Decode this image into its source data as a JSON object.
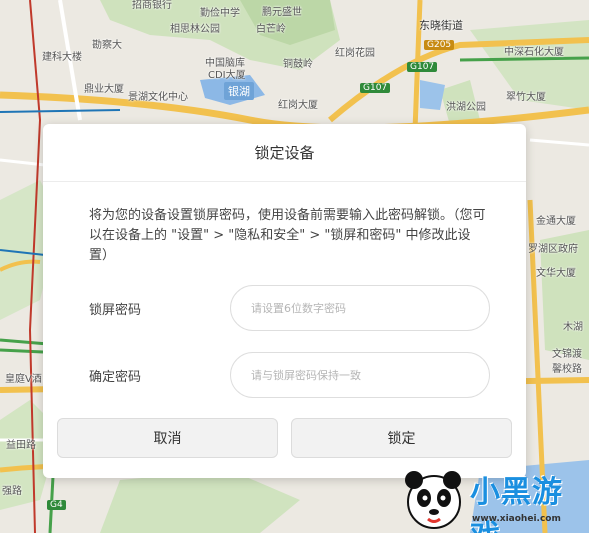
{
  "dialog": {
    "title": "锁定设备",
    "description": "将为您的设备设置锁屏密码，使用设备前需要输入此密码解锁。（您可以在设备上的 \"设置\" > \"隐私和安全\" > \"锁屏和密码\" 中修改此设置）",
    "fields": [
      {
        "label": "锁屏密码",
        "value": "",
        "placeholder": "请设置6位数字密码"
      },
      {
        "label": "确定密码",
        "value": "",
        "placeholder": "请与锁屏密码保持一致"
      }
    ],
    "cancel_label": "取消",
    "confirm_label": "锁定"
  },
  "map": {
    "labels": [
      "招商银行",
      "勤俭中学",
      "鹏元盛世",
      "相思林公园",
      "白芒岭",
      "东晓街道",
      "建科大楼",
      "勘察大",
      "中国脑库",
      "CDI大厦",
      "铜鼓岭",
      "红岗花园",
      "中深石化大厦",
      "鼎业大厦",
      "景湖文化中心",
      "银湖",
      "红岗大厦",
      "洪湖公园",
      "翠竹大厦",
      "金通大厦",
      "罗湖区政府",
      "文华大厦",
      "木湖",
      "文锦渡",
      "馨校路",
      "皇庭V酒",
      "益田路",
      "强路",
      "G4",
      "G205",
      "G107"
    ],
    "lake_label": "银湖",
    "road_badges": [
      "G205",
      "G107",
      "G107",
      "G4"
    ]
  },
  "watermark": {
    "text": "小黑游戏",
    "url": "www.xiaohei.com"
  },
  "colors": {
    "dialog_bg": "#ffffff",
    "button_bg": "#f2f2f2",
    "green_road": "#2f8a3a",
    "yellow_road": "#f2c14e",
    "water": "#8cb8e6",
    "park": "#c9dfb6"
  }
}
